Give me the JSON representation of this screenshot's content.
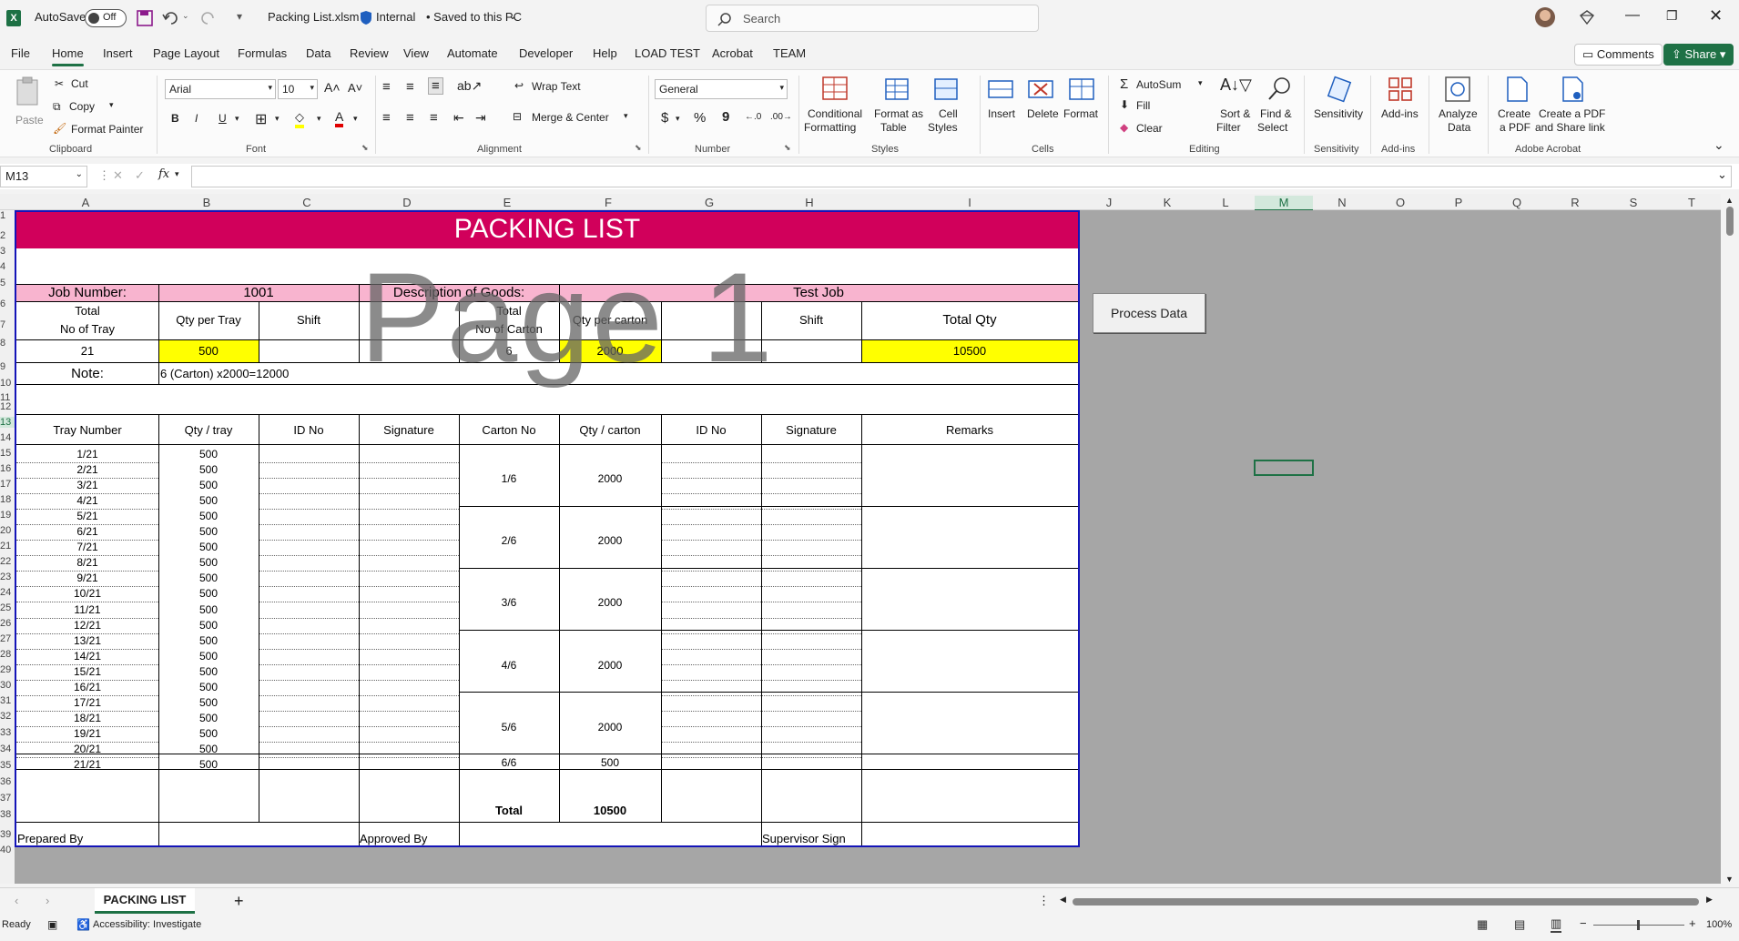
{
  "titlebar": {
    "autosave_label": "AutoSave",
    "autosave_state": "Off",
    "filename": "Packing List.xlsm",
    "sensitivity": "Internal",
    "save_status": "• Saved to this PC",
    "search_placeholder": "Search"
  },
  "menu": {
    "items": [
      "File",
      "Home",
      "Insert",
      "Page Layout",
      "Formulas",
      "Data",
      "Review",
      "View",
      "Automate",
      "Developer",
      "Help",
      "LOAD TEST",
      "Acrobat",
      "TEAM"
    ],
    "active": "Home",
    "comments": "Comments",
    "share": "Share"
  },
  "ribbon": {
    "clipboard": {
      "paste": "Paste",
      "cut": "Cut",
      "copy": "Copy",
      "format_painter": "Format Painter",
      "label": "Clipboard"
    },
    "font": {
      "name": "Arial",
      "size": "10",
      "bold": "B",
      "italic": "I",
      "underline": "U",
      "label": "Font"
    },
    "alignment": {
      "wrap": "Wrap Text",
      "merge": "Merge & Center",
      "label": "Alignment"
    },
    "number": {
      "format": "General",
      "currency": "$",
      "percent": "%",
      "comma": "9",
      "label": "Number"
    },
    "styles": {
      "conditional": "Conditional",
      "conditional2": "Formatting",
      "format_table": "Format as",
      "format_table2": "Table",
      "cell_styles": "Cell",
      "cell_styles2": "Styles",
      "label": "Styles"
    },
    "cells": {
      "insert": "Insert",
      "delete": "Delete",
      "format": "Format",
      "label": "Cells"
    },
    "editing": {
      "autosum": "AutoSum",
      "fill": "Fill",
      "clear": "Clear",
      "sort": "Sort &",
      "sort2": "Filter",
      "find": "Find &",
      "find2": "Select",
      "label": "Editing"
    },
    "sensitivity": {
      "btn": "Sensitivity",
      "label": "Sensitivity"
    },
    "addins": {
      "btn": "Add-ins",
      "label": "Add-ins"
    },
    "analyze": {
      "btn": "Analyze",
      "btn2": "Data"
    },
    "acrobat": {
      "create": "Create",
      "create2": "a PDF",
      "share": "Create a PDF",
      "share2": "and Share link",
      "label": "Adobe Acrobat"
    }
  },
  "formula_bar": {
    "name_box": "M13",
    "fx": "fx",
    "value": ""
  },
  "columns": [
    "A",
    "B",
    "C",
    "D",
    "E",
    "F",
    "G",
    "H",
    "I",
    "J",
    "K",
    "L",
    "M",
    "N",
    "O",
    "P",
    "Q",
    "R",
    "S",
    "T"
  ],
  "rows": [
    "1",
    "2",
    "3",
    "4",
    "5",
    "6",
    "7",
    "8",
    "9",
    "10",
    "11",
    "12",
    "13",
    "14",
    "15",
    "16",
    "17",
    "18",
    "19",
    "20",
    "21",
    "22",
    "23",
    "24",
    "25",
    "26",
    "27",
    "28",
    "29",
    "30",
    "31",
    "32",
    "33",
    "34",
    "35",
    "36",
    "37",
    "38",
    "39",
    "40"
  ],
  "sheet": {
    "title": "PACKING LIST",
    "job_number_label": "Job Number:",
    "job_number": "1001",
    "desc_label": "Description of Goods:",
    "desc_value": "Test Job",
    "h_total_tray_1": "Total",
    "h_total_tray_2": "No of Tray",
    "h_qty_tray": "Qty per Tray",
    "h_shift": "Shift",
    "h_total_carton_1": "Total",
    "h_total_carton_2": "No of Carton",
    "h_qty_carton": "Qty per carton",
    "h_shift2": "Shift",
    "h_total_qty": "Total Qty",
    "v_total_tray": "21",
    "v_qty_tray": "500",
    "v_total_carton": "6",
    "v_qty_carton": "2000",
    "v_total_qty": "10500",
    "note_label": "Note:",
    "note_value": "6 (Carton) x2000=12000",
    "table_headers": [
      "Tray Number",
      "Qty / tray",
      "ID No",
      "Signature",
      "Carton No",
      "Qty / carton",
      "ID No",
      "Signature",
      "Remarks"
    ],
    "trays": [
      "1/21",
      "2/21",
      "3/21",
      "4/21",
      "5/21",
      "6/21",
      "7/21",
      "8/21",
      "9/21",
      "10/21",
      "11/21",
      "12/21",
      "13/21",
      "14/21",
      "15/21",
      "16/21",
      "17/21",
      "18/21",
      "19/21",
      "20/21",
      "21/21"
    ],
    "tray_qty": "500",
    "cartons": [
      {
        "no": "1/6",
        "qty": "2000"
      },
      {
        "no": "2/6",
        "qty": "2000"
      },
      {
        "no": "3/6",
        "qty": "2000"
      },
      {
        "no": "4/6",
        "qty": "2000"
      },
      {
        "no": "5/6",
        "qty": "2000"
      },
      {
        "no": "6/6",
        "qty": "500"
      }
    ],
    "total_label": "Total",
    "total_value": "10500",
    "prepared_by": "Prepared By",
    "approved_by": "Approved By",
    "supervisor_sign": "Supervisor Sign",
    "watermark": "Page 1",
    "process_button": "Process Data"
  },
  "tabs": {
    "sheet_name": "PACKING LIST",
    "add": "+"
  },
  "status": {
    "ready": "Ready",
    "accessibility": "Accessibility: Investigate",
    "zoom": "100%"
  },
  "colors": {
    "title_bg": "#d1005b",
    "header_bg": "#f8b4cf",
    "highlight": "#ffff00",
    "page_border": "#1414b8",
    "accent": "#1e7145"
  }
}
